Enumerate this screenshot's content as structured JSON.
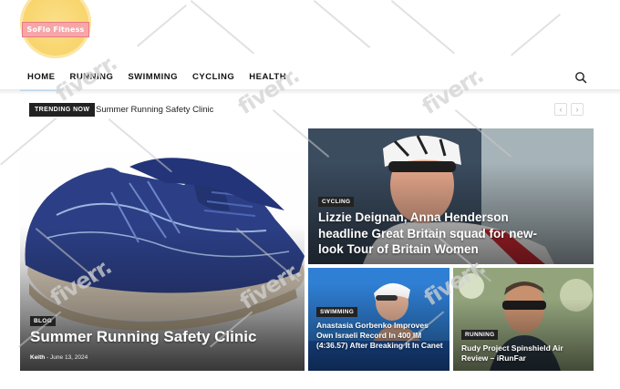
{
  "logo": {
    "text": "SoFlo Fitness"
  },
  "nav": {
    "items": [
      "HOME",
      "RUNNING",
      "SWIMMING",
      "CYCLING",
      "HEALTH"
    ],
    "active": "HOME"
  },
  "trending": {
    "tag": "TRENDING NOW",
    "title": "Summer Running Safety Clinic",
    "prev_icon": "chevron-left-icon",
    "next_icon": "chevron-right-icon"
  },
  "cards": {
    "main": {
      "category": "BLOG",
      "title": "Summer Running Safety Clinic",
      "author": "Keith",
      "date": "June 13, 2024"
    },
    "top": {
      "category": "CYCLING",
      "title": "Lizzie Deignan, Anna Henderson headline Great Britain squad for new-look Tour of Britain Women"
    },
    "bottom_left": {
      "category": "SWIMMING",
      "title": "Anastasia Gorbenko Improves Own Israeli Record In 400 IM (4:36.57) After Breaking It In Canet"
    },
    "bottom_right": {
      "category": "RUNNING",
      "title": "Rudy Project Spinshield Air Review – iRunFar"
    }
  },
  "watermark": "fiverr.",
  "colors": {
    "accent": "#3aa0e8",
    "tag_bg": "#222222",
    "logo_pink": "#f6a6a8",
    "logo_yellow": "#f8d56e"
  }
}
